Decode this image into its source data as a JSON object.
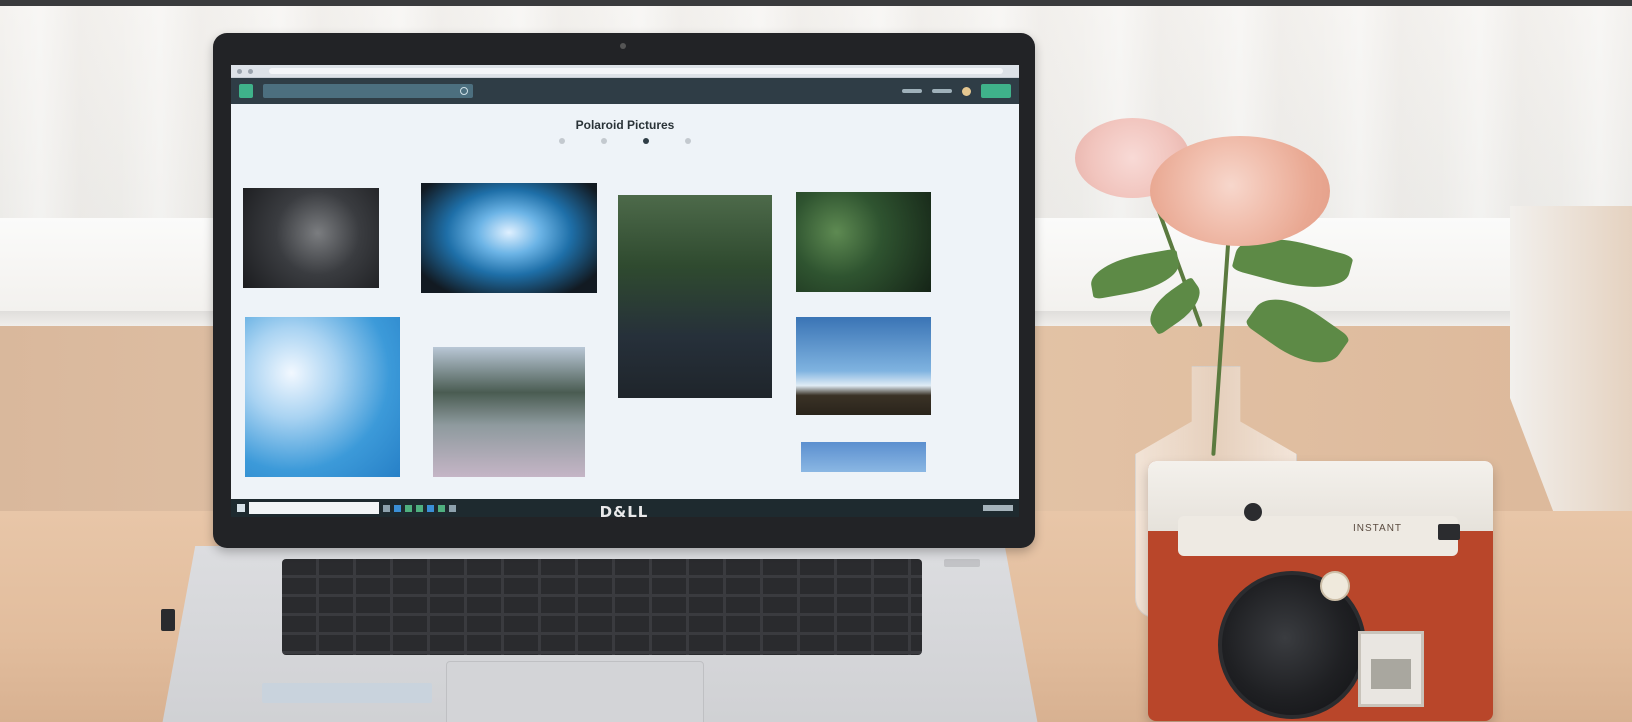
{
  "screen": {
    "page_title": "Polaroid Pictures"
  },
  "laptop": {
    "brand_logo": "D&LL"
  },
  "camera": {
    "brand_text": "INSTANT"
  },
  "colors": {
    "site_nav": "#2f3d46",
    "accent_green": "#3fb28a",
    "camera_body": "#b9462a",
    "desk": "#e2bd9d"
  },
  "icons": [
    "search-icon",
    "windows-start-icon"
  ]
}
